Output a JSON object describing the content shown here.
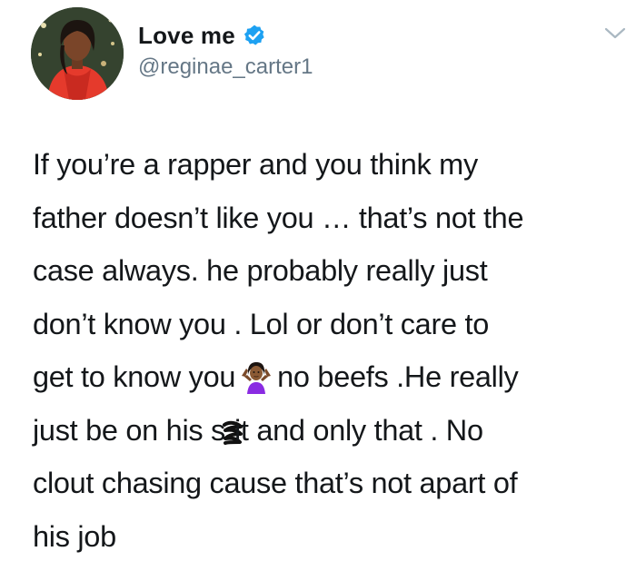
{
  "tweet": {
    "author": {
      "display_name": "Love me",
      "handle": "@reginae_carter1",
      "verified": true,
      "avatar_icon": "profile-photo"
    },
    "menu_icon": "chevron-down-icon",
    "text_lines": [
      {
        "parts": [
          "If you’re a rapper and you think my"
        ]
      },
      {
        "parts": [
          "father doesn’t like you … that’s not the"
        ]
      },
      {
        "parts": [
          "case always. he probably really just"
        ]
      },
      {
        "parts": [
          "don’t know you . Lol or don’t care to"
        ]
      },
      {
        "before": "get to know you",
        "emoji": "person-shrugging-emoji",
        "after": "no beefs .He really"
      },
      {
        "before": "just be on his s",
        "censor": "scribble-censor",
        "after": "it and only that . No"
      },
      {
        "parts": [
          "clout chasing cause that’s not apart of"
        ]
      },
      {
        "parts": [
          "his job"
        ]
      }
    ]
  },
  "colors": {
    "text": "#14171a",
    "handle": "#657786",
    "verified_badge": "#1da1f2",
    "chevron": "#aab8c2",
    "background": "#ffffff"
  }
}
